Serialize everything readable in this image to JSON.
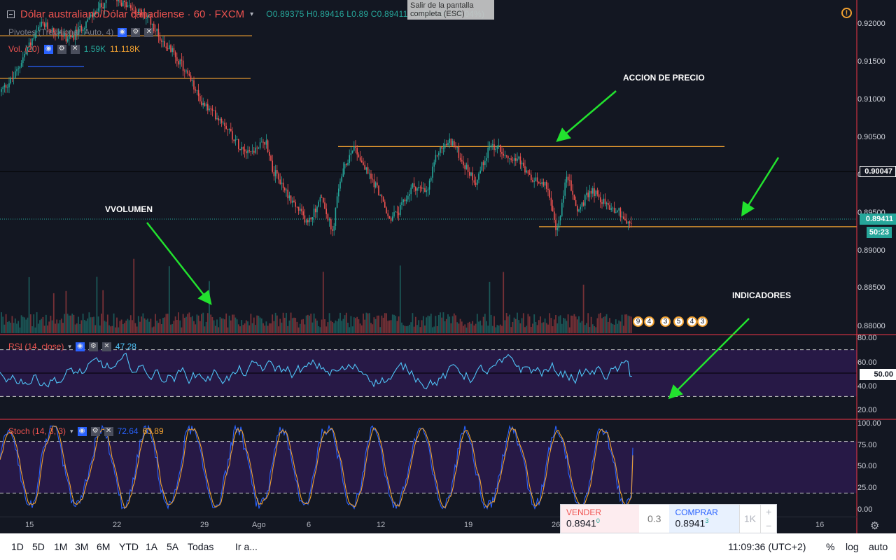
{
  "header": {
    "symbol_title": "Dólar australiano/Dólar canadiense · 60 · FXCM",
    "ohlc": "O0.89375  H0.89416  L0.89     C0.89411  +0.00036 (+0.04%)",
    "fullscreen_tooltip": "Salir de la pantalla completa (ESC)",
    "warning_glyph": "!"
  },
  "indicators": {
    "pivots": "Pivotes (Traditional, Auto, 4)",
    "volume": {
      "label": "Vol. (20)",
      "value1": "1.59K",
      "value2": "11.118K"
    },
    "rsi": {
      "label": "RSI (14, close)",
      "value": "47.28"
    },
    "stoch": {
      "label": "Stoch (14, 3, 3)",
      "value1": "72.64",
      "value2": "63.89"
    }
  },
  "annotations": {
    "price_action": "ACCION DE PRECIO",
    "volume": "VVOLUMEN",
    "indicators": "INDICADORES"
  },
  "price_axis": {
    "ticks": [
      "0.92000",
      "0.91500",
      "0.91000",
      "0.90500",
      "0.90000",
      "0.89500",
      "0.89000",
      "0.88500",
      "0.88000"
    ],
    "crosshair_price": "0.90047",
    "last_price": "0.89411",
    "countdown": "50:23"
  },
  "rsi_axis": {
    "ticks": [
      "80.00",
      "60.00",
      "40.00",
      "20.00"
    ],
    "mid_label": "50.00"
  },
  "stoch_axis": {
    "ticks": [
      "100.00",
      "75.00",
      "50.00",
      "25.00",
      "0.00"
    ]
  },
  "time_axis": {
    "ticks": [
      "15",
      "22",
      "29",
      "Ago",
      "6",
      "12",
      "19",
      "26",
      "16"
    ]
  },
  "event_badges": [
    "9",
    "4",
    "3",
    "5",
    "4",
    "3"
  ],
  "trade_panel": {
    "sell_label": "VENDER",
    "sell_price": "0.8941",
    "sell_sup": "0",
    "spread": "0.3",
    "buy_label": "COMPRAR",
    "buy_price": "0.8941",
    "buy_sup": "3",
    "quantity": "1K",
    "plus": "+",
    "minus": "−"
  },
  "bottom_bar": {
    "ranges": [
      "1D",
      "5D",
      "1M",
      "3M",
      "6M",
      "YTD",
      "1A",
      "5A",
      "Todas"
    ],
    "goto": "Ir a...",
    "clock": "11:09:36 (UTC+2)",
    "percent": "%",
    "log": "log",
    "auto": "auto"
  },
  "colors": {
    "background": "#131722",
    "up": "#26a69a",
    "down": "#ef5350",
    "pivot": "#f0a030",
    "rsi": "#4fc3f7",
    "stoch_k": "#2962ff",
    "stoch_d": "#f0a030",
    "arrow": "#22e22e",
    "panel_fill": "#2a1a4a"
  },
  "chart_data": {
    "type": "candlestick",
    "symbol": "AUD/CAD",
    "timeframe": "60",
    "ylim": [
      0.8795,
      0.9225
    ],
    "x": [
      "15",
      "22",
      "29",
      "Ago",
      "6",
      "12",
      "19",
      "26",
      "16"
    ],
    "close_path": [
      [
        0,
        0.911
      ],
      [
        20,
        0.913
      ],
      [
        40,
        0.917
      ],
      [
        60,
        0.92
      ],
      [
        80,
        0.919
      ],
      [
        100,
        0.918
      ],
      [
        120,
        0.92
      ],
      [
        140,
        0.922
      ],
      [
        160,
        0.924
      ],
      [
        180,
        0.9225
      ],
      [
        200,
        0.9215
      ],
      [
        215,
        0.9205
      ],
      [
        230,
        0.918
      ],
      [
        250,
        0.916
      ],
      [
        270,
        0.913
      ],
      [
        285,
        0.91
      ],
      [
        300,
        0.9085
      ],
      [
        320,
        0.907
      ],
      [
        340,
        0.904
      ],
      [
        360,
        0.903
      ],
      [
        380,
        0.9045
      ],
      [
        390,
        0.9005
      ],
      [
        400,
        0.899
      ],
      [
        420,
        0.896
      ],
      [
        440,
        0.8935
      ],
      [
        460,
        0.897
      ],
      [
        475,
        0.892
      ],
      [
        485,
        0.899
      ],
      [
        505,
        0.904
      ],
      [
        520,
        0.901
      ],
      [
        540,
        0.898
      ],
      [
        555,
        0.894
      ],
      [
        570,
        0.895
      ],
      [
        590,
        0.8985
      ],
      [
        610,
        0.8975
      ],
      [
        625,
        0.903
      ],
      [
        645,
        0.9045
      ],
      [
        665,
        0.901
      ],
      [
        680,
        0.899
      ],
      [
        700,
        0.904
      ],
      [
        720,
        0.903
      ],
      [
        740,
        0.902
      ],
      [
        760,
        0.899
      ],
      [
        780,
        0.899
      ],
      [
        795,
        0.892
      ],
      [
        810,
        0.9
      ],
      [
        825,
        0.895
      ],
      [
        845,
        0.898
      ],
      [
        865,
        0.896
      ],
      [
        885,
        0.895
      ],
      [
        900,
        0.893
      ],
      [
        905,
        0.8941
      ]
    ],
    "pivot_levels": [
      0.9185,
      0.9128,
      0.9037,
      0.893
    ],
    "rsi_last": 47.28,
    "stoch_k_last": 72.64,
    "stoch_d_last": 63.89
  }
}
